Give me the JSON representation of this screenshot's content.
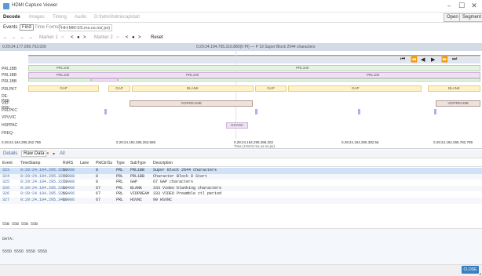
{
  "window": {
    "title": "HDMI Capture Viewer",
    "minimize": "–",
    "maximize": "☐",
    "close": "✕"
  },
  "menu": {
    "items": [
      "Decode",
      "Images",
      "Timing",
      "Audio",
      "D:\\hdmi\\hdmi\\cap\\dat\\"
    ],
    "open_label": "Open",
    "segment_label": "Segment"
  },
  "toolbar": {
    "events_label": "Events",
    "find_label": "Find",
    "time_format_label": "Time Format",
    "time_format_value": "HH:MM:SS.ms.us.ns(.ps)"
  },
  "toolbar2": {
    "items": [
      "←",
      "→",
      "←",
      "→",
      "Marker 1",
      "○",
      "<",
      "●",
      ">",
      "Marker 2",
      "○",
      "<",
      "●",
      ">",
      "Reset"
    ]
  },
  "infobar": {
    "left": "0:29:24.177.099.763.939",
    "right": "0:29:24.194.795.316.880(0 Pt) — P 19 Super Block 2044 characters"
  },
  "timeline": {
    "row_labels": [
      "PRL1BB",
      "PRL1BB",
      "PRL1BB",
      "PRLPKT",
      "DE-PRE",
      "VID-PRE",
      "PRLPKC",
      "VPVVIC",
      "HSPPAC",
      "FREQ-"
    ],
    "navigation_buttons": [
      "⏮",
      "⏪",
      "◀",
      "▶",
      "⏩",
      "⏭"
    ],
    "bars": {
      "prl100_a": "PRL100",
      "prl100_b": "PRL100",
      "prl100_c": "PRL100",
      "prl100_d": "PRL100",
      "prl100_e": "PRL100",
      "gap_a": "GAP",
      "gap_b": "GAP",
      "blank_a": "BLANK",
      "gap_c": "GAP",
      "gap_d": "GAP",
      "blank_b": "BLANK",
      "vid_a": "VIDPREAMB",
      "vid_b": "VIDPREAMB",
      "hsync": "HSYNC"
    },
    "ticks": [
      "0.29:24.194.295.252.786",
      "0.29:24.194.295.253.588",
      "0.29:24.194.295.368.202",
      "0.29:24.194.295.382.56",
      "0.29:24.194.295.782.799"
    ],
    "tick_sub": "Time (H:M:S.ms.us.ns.ps)"
  },
  "details": {
    "tabs": [
      "Details",
      "Raw Data",
      "●",
      "▾",
      "All"
    ],
    "columns": [
      "Event",
      "TimeStamp",
      "RxRS",
      "Lane",
      "PktCtr/Sz",
      "Type",
      "SubType",
      "Description"
    ],
    "rows": [
      {
        "event": "323",
        "ts": "0:29:24.194.295.325.998",
        "rx": "19",
        "lane": "",
        "ctr": "8",
        "type": "PRL",
        "sub": "PRL1BB",
        "desc": "Super Block 2044 characters"
      },
      {
        "event": "324",
        "ts": "0:29:24.194.295.327.988",
        "rx": "19",
        "lane": "",
        "ctr": "8",
        "type": "PRL",
        "sub": "PRL1BB",
        "desc": "Character Block 8 Start"
      },
      {
        "event": "325",
        "ts": "0:29:24.194.295.327.988",
        "rx": "19",
        "lane": "",
        "ctr": "8",
        "type": "PRL",
        "sub": "GAP",
        "desc": "67 GAP characters"
      },
      {
        "event": "326",
        "ts": "0:29:24.194.295.335.466",
        "rx": "19",
        "lane": "",
        "ctr": "67",
        "type": "PRL",
        "sub": "BLANK",
        "desc": "333 Video blanking characters"
      },
      {
        "event": "326",
        "ts": "0:29:24.194.295.335.466",
        "rx": "19",
        "lane": "",
        "ctr": "67",
        "type": "PRL",
        "sub": "VIDPREAM",
        "desc": "333 VIDEO Preamble ctl period"
      },
      {
        "event": "327",
        "ts": "0:29:24.194.295.346.986",
        "rx": "19",
        "lane": "",
        "ctr": "67",
        "type": "PRL",
        "sub": "HSVNC",
        "desc": "99 HSVNC"
      }
    ]
  },
  "hex": {
    "line1": "55B 55B 55B 55B"
  },
  "detail_panel": {
    "data_label": "DATA:",
    "data_value": "555D 555D 555D 555D"
  },
  "status": {
    "close_label": "CLOSE"
  }
}
